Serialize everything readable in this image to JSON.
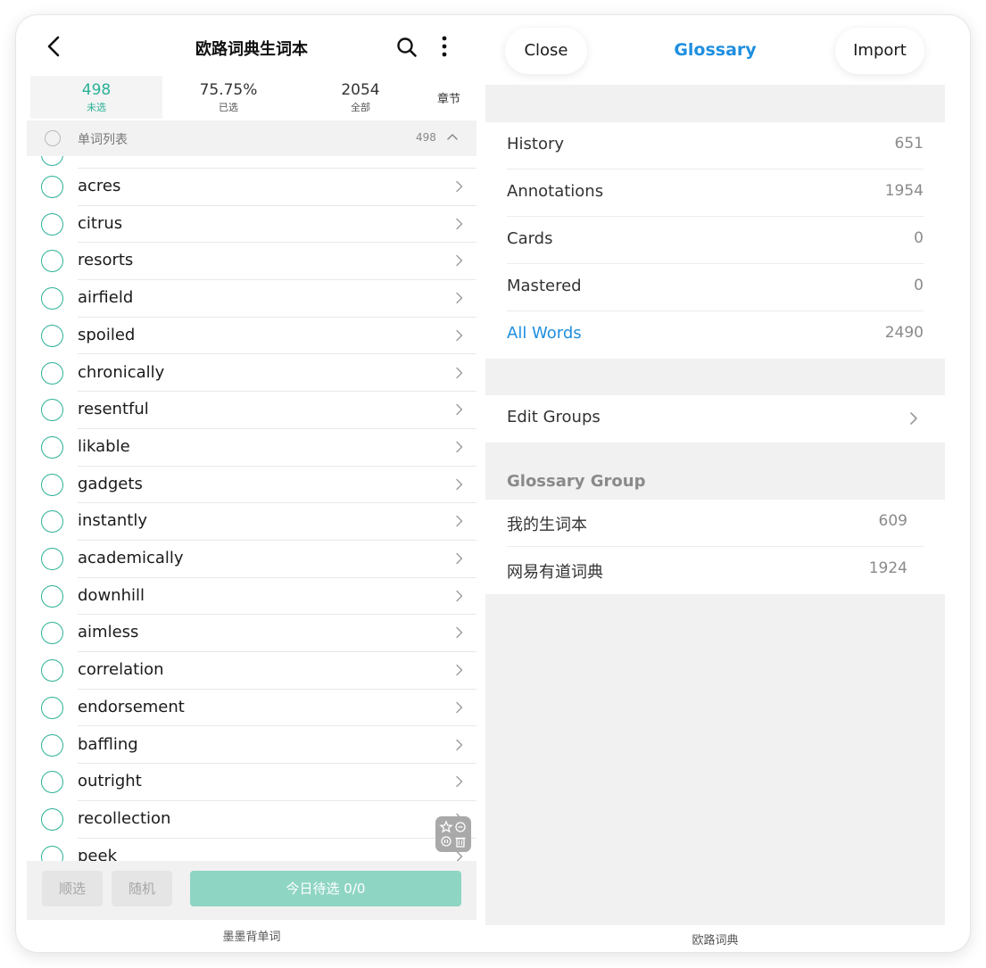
{
  "left_app": {
    "header": {
      "title": "欧路词典生词本"
    },
    "stats": [
      {
        "value": "498",
        "label": "未选"
      },
      {
        "value": "75.75%",
        "label": "已选"
      },
      {
        "value": "2054",
        "label": "全部"
      }
    ],
    "chapter_label": "章节",
    "list_header": {
      "title": "单词列表",
      "count": "498"
    },
    "words": [
      "acres",
      "citrus",
      "resorts",
      "airfield",
      "spoiled",
      "chronically",
      "resentful",
      "likable",
      "gadgets",
      "instantly",
      "academically",
      "downhill",
      "aimless",
      "correlation",
      "endorsement",
      "baffling",
      "outright",
      "recollection",
      "peek"
    ],
    "buttons": {
      "sequential": "顺选",
      "random": "随机",
      "today": "今日待选 0/0"
    },
    "caption": "墨墨背单词",
    "colors": {
      "accent": "#2bb197",
      "today_button": "#8fd5c4"
    }
  },
  "right_app": {
    "buttons": {
      "close": "Close",
      "import": "Import"
    },
    "title": "Glossary",
    "rows": [
      {
        "name": "History",
        "value": "651"
      },
      {
        "name": "Annotations",
        "value": "1954"
      },
      {
        "name": "Cards",
        "value": "0"
      },
      {
        "name": "Mastered",
        "value": "0"
      },
      {
        "name": "All Words",
        "value": "2490"
      }
    ],
    "edit_groups": "Edit Groups",
    "group_header": "Glossary Group",
    "groups": [
      {
        "name": "我的生词本",
        "value": "609"
      },
      {
        "name": "网易有道词典",
        "value": "1924"
      }
    ],
    "caption": "欧路词典",
    "colors": {
      "accent": "#1f8fe0"
    }
  }
}
